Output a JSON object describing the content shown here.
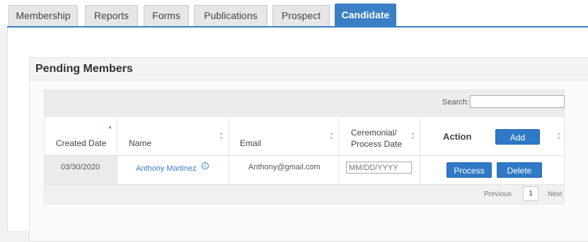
{
  "tabs": [
    {
      "label": "Membership"
    },
    {
      "label": "Reports"
    },
    {
      "label": "Forms"
    },
    {
      "label": "Publications"
    },
    {
      "label": "Prospect"
    },
    {
      "label": "Candidate"
    }
  ],
  "active_tab": "Candidate",
  "panel": {
    "title": "Pending Members"
  },
  "search": {
    "label": "Search:",
    "value": ""
  },
  "columns": {
    "created_date": "Created Date",
    "name": "Name",
    "email": "Email",
    "ceremonial_line1": "Ceremonial/",
    "ceremonial_line2": "Process Date",
    "action": "Action"
  },
  "buttons": {
    "add": "Add",
    "process": "Process",
    "delete": "Delete"
  },
  "rows": [
    {
      "created_date": "03/30/2020",
      "name": "Anthony Martinez",
      "email": "Anthony@gmail.com",
      "date_placeholder": "MM/DD/YYYY"
    }
  ],
  "pagination": {
    "previous": "Previous",
    "page": "1",
    "next": "Next"
  },
  "colors": {
    "accent": "#3b7fc4",
    "button": "#2f79c6",
    "link": "#3a7dc9"
  }
}
